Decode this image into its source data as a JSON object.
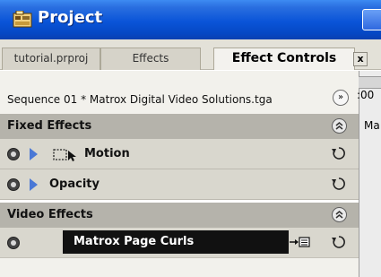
{
  "window": {
    "title": "Project"
  },
  "tabs": [
    {
      "label": "tutorial.prproj",
      "active": false
    },
    {
      "label": "Effects",
      "active": false
    },
    {
      "label": "Effect Controls",
      "active": true
    }
  ],
  "tab_close": "x",
  "sequence": {
    "label": "Sequence 01 * Matrox Digital Video Solutions.tga",
    "nav_button": "»"
  },
  "timeline": {
    "timecode": ":00",
    "clip_label": "Ma"
  },
  "sections": {
    "fixed": {
      "label": "Fixed Effects",
      "effects": [
        {
          "label": "Motion",
          "icon": "motion-icon"
        },
        {
          "label": "Opacity",
          "icon": null
        }
      ]
    },
    "video": {
      "label": "Video Effects",
      "effects": [
        {
          "label": "Matrox Page Curls",
          "selected": true
        }
      ]
    }
  },
  "colors": {
    "titlebar": "#0a54d8",
    "section_header": "#b5b3ab",
    "effect_row": "#d9d7ce",
    "selected_bar": "#111111",
    "twirl_arrow": "#4a78d6"
  }
}
